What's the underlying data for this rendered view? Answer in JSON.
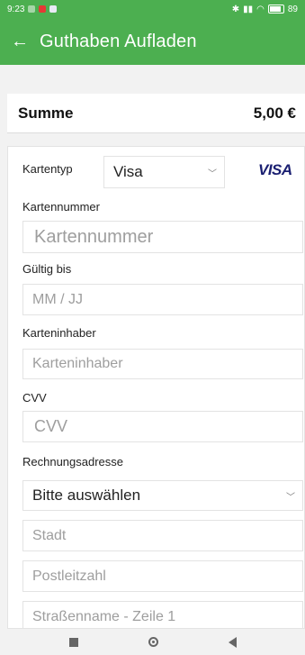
{
  "status_bar": {
    "time": "9:23",
    "battery": "89"
  },
  "app_bar": {
    "title": "Guthaben Aufladen",
    "back_icon": "arrow-back-icon"
  },
  "summary": {
    "label": "Summe",
    "value": "5,00 €"
  },
  "form": {
    "card_type_label": "Kartentyp",
    "card_type_value": "Visa",
    "card_brand": "VISA",
    "card_number_label": "Kartennummer",
    "card_number_placeholder": "Kartennummer",
    "expiry_label": "Gültig bis",
    "expiry_placeholder": "MM / JJ",
    "holder_label": "Karteninhaber",
    "holder_placeholder": "Karteninhaber",
    "cvv_label": "CVV",
    "cvv_placeholder": "CVV",
    "billing_label": "Rechnungsadresse",
    "billing_select_value": "Bitte auswählen",
    "city_placeholder": "Stadt",
    "postal_placeholder": "Postleitzahl",
    "street_placeholder": "Straßenname - Zeile 1"
  },
  "colors": {
    "brand_green": "#4caf50",
    "visa_blue": "#1a1f71"
  }
}
